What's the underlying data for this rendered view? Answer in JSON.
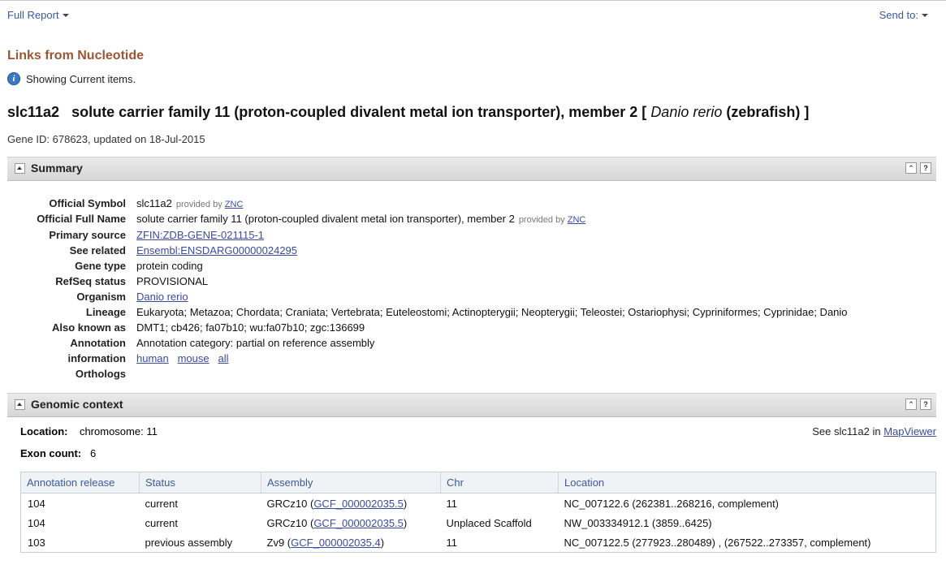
{
  "topbar": {
    "full_report": "Full Report",
    "send_to": "Send to:"
  },
  "links_title": "Links from Nucleotide",
  "showing": "Showing Current items.",
  "gene": {
    "symbol": "slc11a2",
    "name": "solute carrier family 11 (proton-coupled divalent metal ion transporter), member 2",
    "open_bracket": "[",
    "species_italic": "Danio rerio",
    "species_common": "(zebrafish)",
    "close_bracket": "]",
    "id_line": "Gene ID: 678623, updated on 18-Jul-2015"
  },
  "summary": {
    "title": "Summary",
    "rows": {
      "official_symbol": {
        "label": "Official Symbol",
        "value": "slc11a2",
        "provided": "provided by",
        "provider": "ZNC"
      },
      "official_full_name": {
        "label": "Official Full Name",
        "value": "solute carrier family 11 (proton-coupled divalent metal ion transporter), member 2",
        "provided": "provided by",
        "provider": "ZNC"
      },
      "primary_source": {
        "label": "Primary source",
        "value": "ZFIN:ZDB-GENE-021115-1"
      },
      "see_related": {
        "label": "See related",
        "value": "Ensembl:ENSDARG00000024295"
      },
      "gene_type": {
        "label": "Gene type",
        "value": "protein coding"
      },
      "refseq_status": {
        "label": "RefSeq status",
        "value": "PROVISIONAL"
      },
      "organism": {
        "label": "Organism",
        "value": "Danio rerio"
      },
      "lineage": {
        "label": "Lineage",
        "value": "Eukaryota; Metazoa; Chordata; Craniata; Vertebrata; Euteleostomi; Actinopterygii; Neopterygii; Teleostei; Ostariophysi; Cypriniformes; Cyprinidae; Danio"
      },
      "also_known_as": {
        "label": "Also known as",
        "value": "DMT1; cb426; fa07b10; wu:fa07b10; zgc:136699"
      },
      "annotation": {
        "label": "Annotation",
        "value": "Annotation category: partial on reference assembly"
      },
      "information": {
        "label": "information",
        "links": [
          "human",
          "mouse",
          "all"
        ]
      },
      "orthologs": {
        "label": "Orthologs"
      }
    }
  },
  "genomic": {
    "title": "Genomic context",
    "location_label": "Location:",
    "location_value": "chromosome: 11",
    "exon_label": "Exon count:",
    "exon_value": "6",
    "see_map_prefix": "See slc11a2 in",
    "see_map_link": "MapViewer",
    "table": {
      "headers": [
        "Annotation release",
        "Status",
        "Assembly",
        "Chr",
        "Location"
      ],
      "rows": [
        {
          "release": "104",
          "status": "current",
          "assembly": "GRCz10",
          "assembly_acc": "GCF_000002035.5",
          "chr": "11",
          "location": "NC_007122.6 (262381..268216, complement)"
        },
        {
          "release": "104",
          "status": "current",
          "assembly": "GRCz10",
          "assembly_acc": "GCF_000002035.5",
          "chr": "Unplaced Scaffold",
          "location": "NW_003334912.1 (3859..6425)"
        },
        {
          "release": "103",
          "status": "previous assembly",
          "assembly": "Zv9",
          "assembly_acc": "GCF_000002035.4",
          "chr": "11",
          "location": "NC_007122.5 (277923..280489) , (267522..273357, complement)"
        }
      ]
    }
  },
  "section_buttons": {
    "collapse_all": "⌃",
    "help": "?"
  }
}
